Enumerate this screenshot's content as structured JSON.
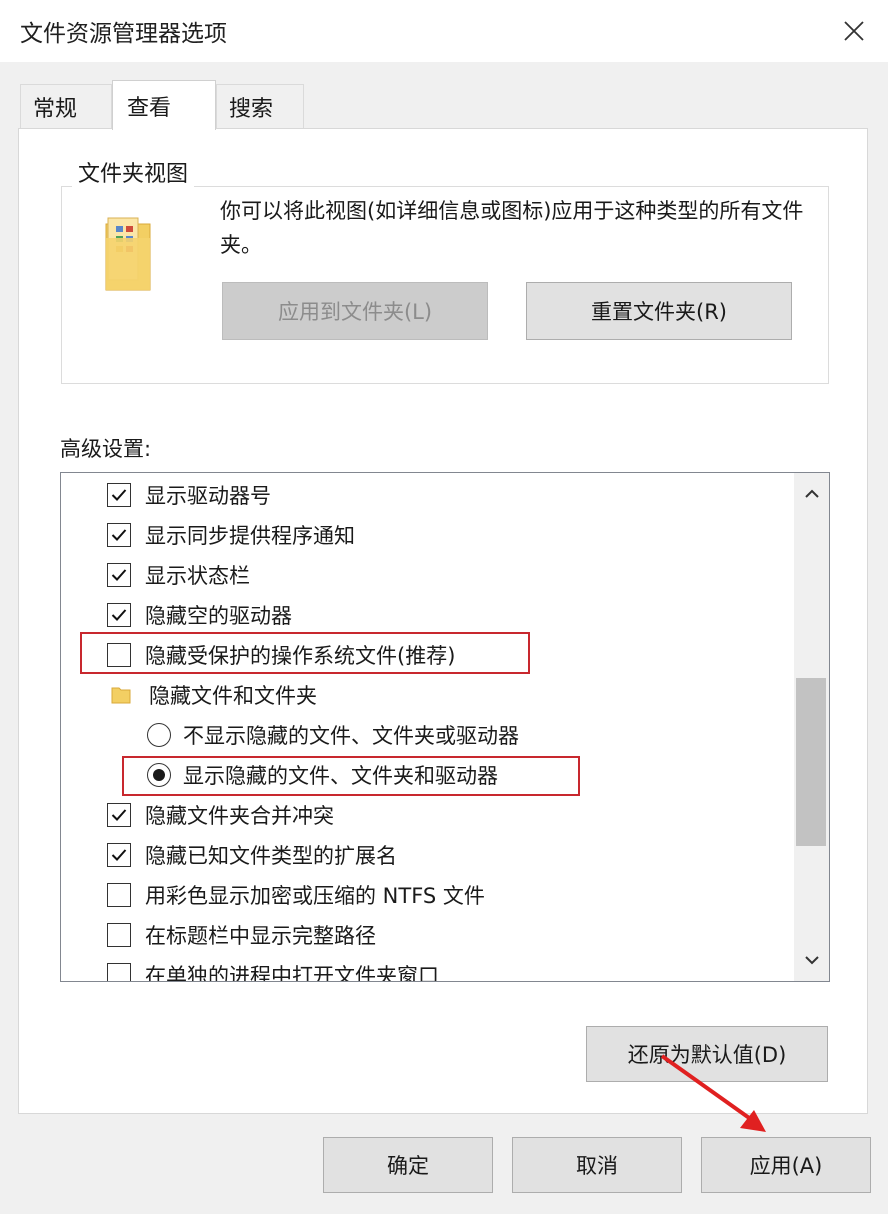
{
  "window": {
    "title": "文件资源管理器选项",
    "close_icon": "close-icon"
  },
  "tabs": [
    {
      "label": "常规"
    },
    {
      "label": "查看",
      "active": true
    },
    {
      "label": "搜索"
    }
  ],
  "folder_views": {
    "title": "文件夹视图",
    "description": "你可以将此视图(如详细信息或图标)应用于这种类型的所有文件夹。",
    "apply_button": "应用到文件夹(L)",
    "reset_button": "重置文件夹(R)"
  },
  "advanced": {
    "label": "高级设置:",
    "items": [
      {
        "label": "显示驱动器号",
        "kind": "checkbox",
        "checked": true
      },
      {
        "label": "显示同步提供程序通知",
        "kind": "checkbox",
        "checked": true
      },
      {
        "label": "显示状态栏",
        "kind": "checkbox",
        "checked": true
      },
      {
        "label": "隐藏空的驱动器",
        "kind": "checkbox",
        "checked": true
      },
      {
        "label": "隐藏受保护的操作系统文件(推荐)",
        "kind": "checkbox",
        "checked": false
      },
      {
        "label": "隐藏文件和文件夹",
        "kind": "folder"
      },
      {
        "label": "不显示隐藏的文件、文件夹或驱动器",
        "kind": "radio",
        "checked": false
      },
      {
        "label": "显示隐藏的文件、文件夹和驱动器",
        "kind": "radio",
        "checked": true
      },
      {
        "label": "隐藏文件夹合并冲突",
        "kind": "checkbox",
        "checked": true
      },
      {
        "label": "隐藏已知文件类型的扩展名",
        "kind": "checkbox",
        "checked": true
      },
      {
        "label": "用彩色显示加密或压缩的 NTFS 文件",
        "kind": "checkbox",
        "checked": false
      },
      {
        "label": "在标题栏中显示完整路径",
        "kind": "checkbox",
        "checked": false
      },
      {
        "label": "在单独的进程中打开文件夹窗口",
        "kind": "checkbox",
        "checked": false
      }
    ]
  },
  "restore_button": "还原为默认值(D)",
  "footer": {
    "ok": "确定",
    "cancel": "取消",
    "apply": "应用(A)"
  },
  "colors": {
    "highlight": "#c8282e",
    "arrow": "#e02020",
    "panel": "#ffffff",
    "chrome": "#f0f0f0"
  }
}
